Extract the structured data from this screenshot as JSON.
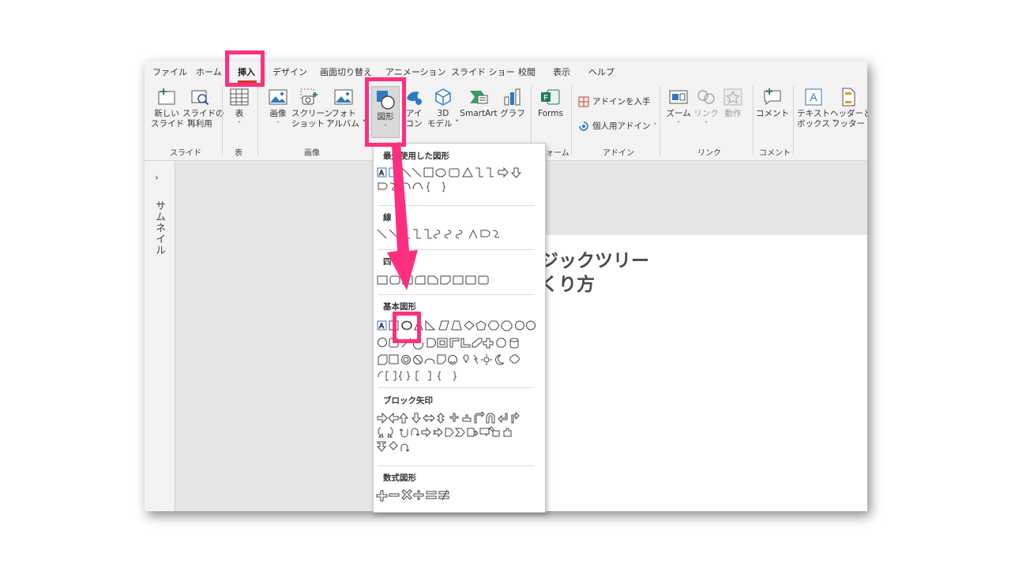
{
  "tabs": [
    "ファイル",
    "ホーム",
    "挿入",
    "デザイン",
    "画面切り替え",
    "アニメーション",
    "スライド ショー",
    "校閲",
    "表示",
    "ヘルプ"
  ],
  "ribbon": {
    "new_slide": [
      "新しい",
      "スライド ˅"
    ],
    "reuse_slide": [
      "スライドの",
      "再利用"
    ],
    "table": "表",
    "image": "画像",
    "screenshot": [
      "スクリーン",
      "ショット ˅"
    ],
    "photo_album": [
      "フォト",
      "アルバム ˅"
    ],
    "shapes": "図形",
    "icons": [
      "アイ",
      "コン"
    ],
    "model3d": [
      "3D",
      "モデル ˅"
    ],
    "smartart": "SmartArt",
    "graph": "グラフ",
    "forms": "Forms",
    "get_addins": "アドインを入手",
    "my_addins": "個人用アドイン",
    "zoom": "ズーム",
    "link": "リンク",
    "action": "動作",
    "comment": "コメント",
    "textbox": [
      "テキスト",
      "ボックス ˅"
    ],
    "header_footer": [
      "ヘッダーと",
      "フッター"
    ],
    "groups": {
      "slide": "スライド",
      "table": "表",
      "image": "画像",
      "forms": "ォーム",
      "addins": "アドイン",
      "link": "リンク",
      "comment": "コメント"
    }
  },
  "thumbnail_pane": {
    "chevron": "›",
    "label": "サムネイル"
  },
  "slide": {
    "title_line1": "ジックツリー",
    "title_line2": "くり方"
  },
  "gallery": {
    "recent": "最近使用した図形",
    "lines": "線",
    "rectangles": "四",
    "basic": "基本図形",
    "block_arrows": "ブロック矢印",
    "equation": "数式図形"
  },
  "colors": {
    "highlight": "#ff2e7e",
    "accent": "#c43e1c"
  }
}
